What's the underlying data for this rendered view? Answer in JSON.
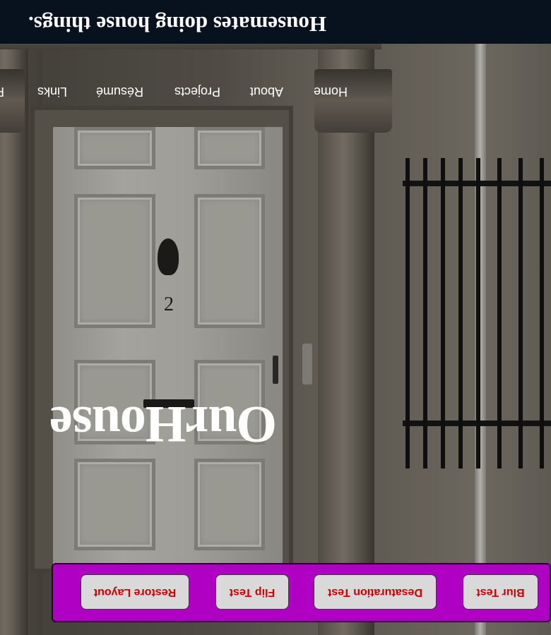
{
  "site": {
    "header_title": "Housemates doing house things.",
    "hero_title": "OurHouse"
  },
  "nav": {
    "items": [
      {
        "label": "Home"
      },
      {
        "label": "About"
      },
      {
        "label": "Projects"
      },
      {
        "label": "Résumé"
      },
      {
        "label": "Links"
      },
      {
        "label": "F"
      }
    ]
  },
  "door": {
    "number": "2"
  },
  "toolbar": {
    "background": "#b000c4",
    "buttons": [
      {
        "label": "Blur Test"
      },
      {
        "label": "Desaturation Test"
      },
      {
        "label": "Flip Test"
      },
      {
        "label": "Restore Layout"
      }
    ]
  },
  "view": {
    "orientation": "flipped"
  }
}
